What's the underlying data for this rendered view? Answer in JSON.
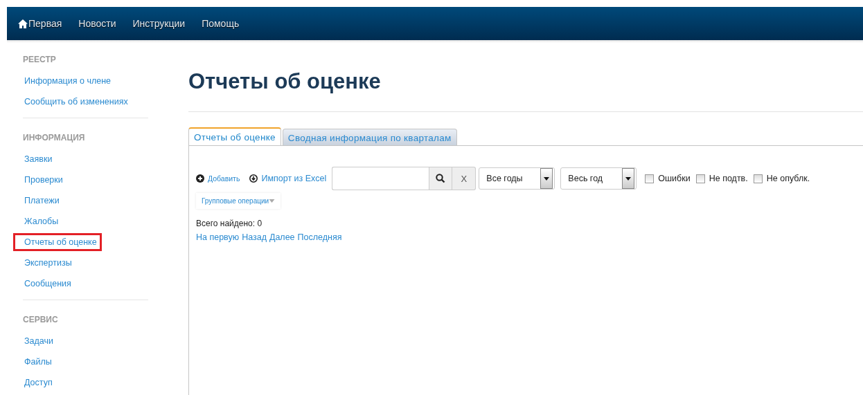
{
  "navbar": {
    "items": [
      {
        "label": "Первая",
        "kind": "home"
      },
      {
        "label": "Новости",
        "kind": "link"
      },
      {
        "label": "Инструкции",
        "kind": "link"
      },
      {
        "label": "Помощь",
        "kind": "link"
      }
    ]
  },
  "sidebar": {
    "sections": [
      {
        "title": "РЕЕСТР",
        "items": [
          {
            "label": "Информация о члене",
            "selected": false
          },
          {
            "label": "Сообщить об изменениях",
            "selected": false
          }
        ]
      },
      {
        "title": "ИНФОРМАЦИЯ",
        "items": [
          {
            "label": "Заявки",
            "selected": false
          },
          {
            "label": "Проверки",
            "selected": false
          },
          {
            "label": "Платежи",
            "selected": false
          },
          {
            "label": "Жалобы",
            "selected": false
          },
          {
            "label": "Отчеты об оценке",
            "selected": true
          },
          {
            "label": "Экспертизы",
            "selected": false
          },
          {
            "label": "Сообщения",
            "selected": false
          }
        ]
      },
      {
        "title": "СЕРВИС",
        "items": [
          {
            "label": "Задачи",
            "selected": false
          },
          {
            "label": "Файлы",
            "selected": false
          },
          {
            "label": "Доступ",
            "selected": false
          }
        ]
      }
    ]
  },
  "page_title": "Отчеты об оценке",
  "tabs": [
    {
      "label": "Отчеты об оценке",
      "selected": true
    },
    {
      "label": "Сводная информация по кварталам",
      "selected": false
    }
  ],
  "toolbar": {
    "add_link": "Добавить",
    "import_link": "Импорт из Excel",
    "clear_button": "X",
    "selects": [
      {
        "value": "Все годы"
      },
      {
        "value": "Весь год"
      }
    ],
    "checkboxes": [
      {
        "label": "Ошибки",
        "checked": false
      },
      {
        "label": "Не подтв.",
        "checked": false
      },
      {
        "label": "Не опублк.",
        "checked": false
      }
    ],
    "group_menu": "Групповые операции"
  },
  "total_found": "Всего найдено: 0",
  "pager": [
    "На первую",
    "Назад",
    "Далее",
    "Последняя"
  ]
}
